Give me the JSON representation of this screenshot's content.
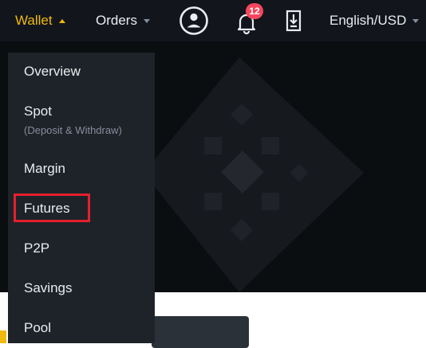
{
  "nav": {
    "wallet_label": "Wallet",
    "orders_label": "Orders",
    "notifications_count": "12",
    "language_currency_label": "English/USD"
  },
  "wallet_menu": {
    "overview": "Overview",
    "spot": "Spot",
    "spot_sub": "(Deposit & Withdraw)",
    "margin": "Margin",
    "futures": "Futures",
    "p2p": "P2P",
    "savings": "Savings",
    "pool": "Pool"
  },
  "colors": {
    "accent": "#f0b90b",
    "topbar_bg": "#12161c",
    "menu_bg": "#1e2329",
    "highlight_box": "#e5202c",
    "badge": "#f6465d"
  },
  "icons": [
    "user-account-icon",
    "bell-icon",
    "download-icon",
    "caret-up-icon",
    "caret-down-icon"
  ]
}
